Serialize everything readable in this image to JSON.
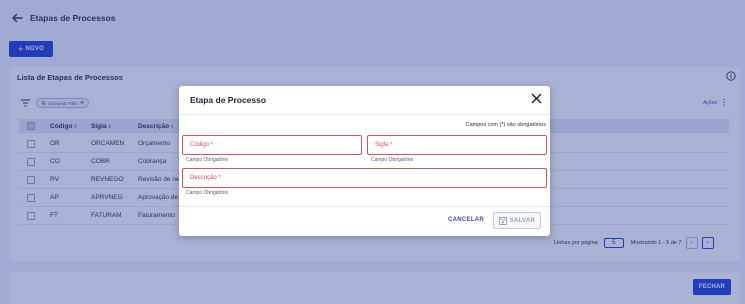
{
  "header": {
    "title": "Etapas de Processos",
    "back_icon": "arrow-left-icon"
  },
  "toolbar": {
    "new_label": "NOVO",
    "new_icon": "+"
  },
  "list": {
    "title": "Lista de Etapas de Processos",
    "filter_chip_label": "Adicionar Filtro",
    "filter_chip_plus": "⊕",
    "filter_chip_close": "⊗",
    "actions_label": "Ações",
    "columns": {
      "code": "Código",
      "sigla": "Sigla",
      "desc": "Descrição"
    },
    "sort_icon": "⇕",
    "rows": [
      {
        "code": "OR",
        "sigla": "ORCAMEN",
        "desc": "Orçamento"
      },
      {
        "code": "CO",
        "sigla": "COBR",
        "desc": "Cobrança"
      },
      {
        "code": "RV",
        "sigla": "REVNEGO",
        "desc": "Revisão de ne"
      },
      {
        "code": "AP",
        "sigla": "APRVNEG",
        "desc": "Aprovação de"
      },
      {
        "code": "FT",
        "sigla": "FATURAM",
        "desc": "Faturamento"
      }
    ],
    "pagination": {
      "rows_per_page_label": "Linhas por página",
      "rows_per_page_value": "5",
      "range_label": "Mostrando 1 - 5 de 7",
      "prev_label": "‹",
      "next_label": "›"
    }
  },
  "footer": {
    "close_label": "FECHAR"
  },
  "modal": {
    "title": "Etapa de Processo",
    "required_note": "Campos com (*) são obrigatórios",
    "fields": {
      "codigo": {
        "label": "Código *",
        "helper": "Campo Obrigatório"
      },
      "sigla": {
        "label": "Sigla *",
        "helper": "Campo Obrigatório"
      },
      "descricao": {
        "label": "Descrição *",
        "helper": "Campo Obrigatório"
      }
    },
    "cancel_label": "CANCELAR",
    "save_label": "SALVAR"
  },
  "colors": {
    "primary": "#1f3fd3",
    "error": "#d6515a",
    "overlay": "rgba(40, 60, 150, 0.40)"
  }
}
